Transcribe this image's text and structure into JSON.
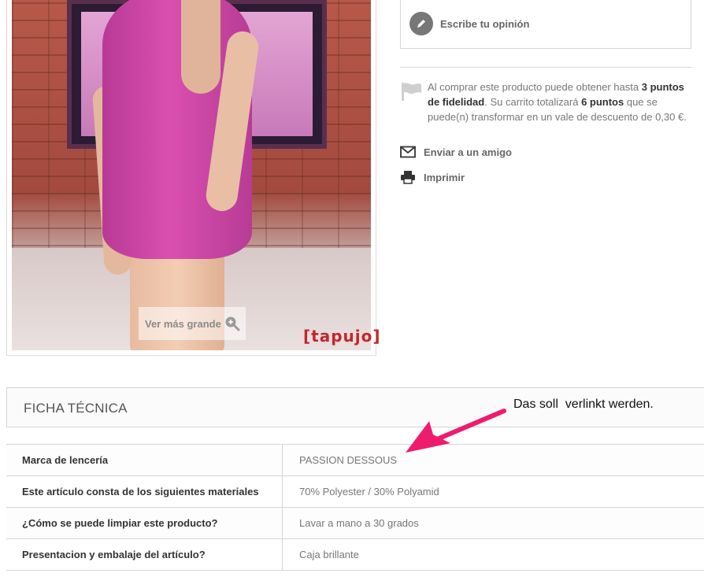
{
  "product_image": {
    "zoom_label": "Ver más grande",
    "brand_mark": "[tapujo]"
  },
  "review": {
    "label": "Escribe tu opinión"
  },
  "loyalty": {
    "text_1": "Al comprar este producto puede obtener hasta ",
    "points_earn": "3 puntos de fidelidad",
    "text_2": ". Su carrito totalizará ",
    "points_total": "6 puntos",
    "text_3": " que se puede(n) transformar en un vale de descuento de 0,30 €."
  },
  "actions": {
    "send_friend": "Enviar a un amigo",
    "print": "Imprimir"
  },
  "ficha": {
    "title": "Ficha técnica",
    "rows": [
      {
        "key": "Marca de lencería",
        "value": "PASSION DESSOUS"
      },
      {
        "key": "Este artículo consta de los siguientes materiales",
        "value": "70% Polyester / 30% Polyamid"
      },
      {
        "key": "¿Cómo se puede limpiar este producto?",
        "value": "Lavar a mano a 30 grados"
      },
      {
        "key": "Presentacion y embalaje del artículo?",
        "value": "Caja brillante"
      }
    ]
  },
  "annotation": {
    "text": "Das soll  verlinkt werden.",
    "color": "#ee1c6f"
  },
  "colors": {
    "dress": "#d94fb0",
    "brand_red": "#c0282e"
  }
}
